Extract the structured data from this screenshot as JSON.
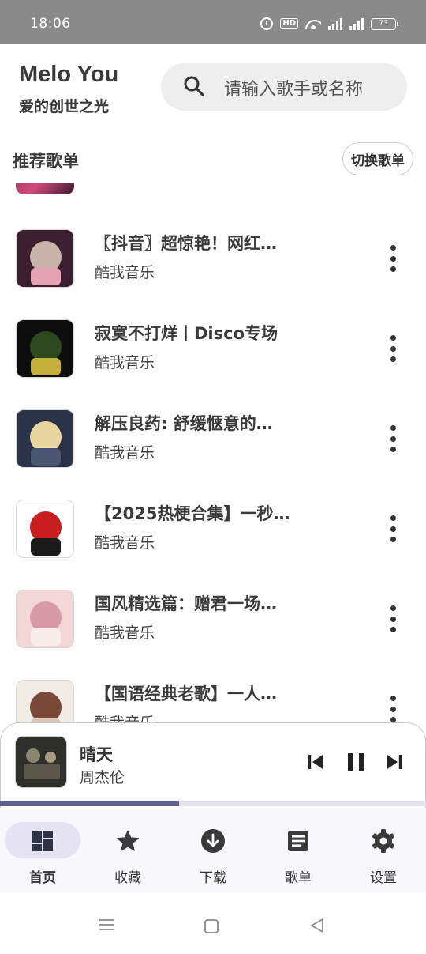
{
  "status_bar": {
    "time": "18:06",
    "hd_label": "HD",
    "battery": "73",
    "icons": [
      "alarm-icon",
      "hd-icon",
      "wifi-icon",
      "signal-icon",
      "signal-icon",
      "battery-icon"
    ]
  },
  "header": {
    "title": "Melo You",
    "subtitle": "爱的创世之光",
    "search_placeholder": "请输入歌手或名称"
  },
  "section": {
    "title": "推荐歌单",
    "switch_label": "切换歌单"
  },
  "playlists": [
    {
      "title": "〖抖音〗超惊艳！网红…",
      "source": "酷我音乐",
      "thumb_colors": [
        "#3b1f2e",
        "#c7b3a8",
        "#e7a3b6"
      ]
    },
    {
      "title": "寂寞不打烊丨Disco专场",
      "source": "酷我音乐",
      "thumb_colors": [
        "#0d0d0d",
        "#2d4a1e",
        "#c5b13a"
      ]
    },
    {
      "title": "解压良药: 舒缓惬意的…",
      "source": "酷我音乐",
      "thumb_colors": [
        "#2a3348",
        "#e8d8a0",
        "#4b5670"
      ]
    },
    {
      "title": "【2025热梗合集】一秒…",
      "source": "酷我音乐",
      "thumb_colors": [
        "#ffffff",
        "#c81e1e",
        "#1a1a1a"
      ]
    },
    {
      "title": "国风精选篇：赠君一场…",
      "source": "酷我音乐",
      "thumb_colors": [
        "#f3d6d8",
        "#d89aa4",
        "#f7eee8"
      ]
    },
    {
      "title": "【国语经典老歌】一人…",
      "source": "酷我音乐",
      "thumb_colors": [
        "#f1ece6",
        "#7a4a38",
        "#d9c7b8"
      ]
    }
  ],
  "player": {
    "title": "晴天",
    "artist": "周杰伦",
    "progress": 0.42,
    "controls": [
      "skip-previous-icon",
      "pause-icon",
      "skip-next-icon"
    ]
  },
  "bottom_nav": [
    {
      "label": "首页",
      "icon": "dashboard-icon",
      "active": true
    },
    {
      "label": "收藏",
      "icon": "star-icon",
      "active": false
    },
    {
      "label": "下载",
      "icon": "download-icon",
      "active": false
    },
    {
      "label": "歌单",
      "icon": "playlist-icon",
      "active": false
    },
    {
      "label": "设置",
      "icon": "gear-icon",
      "active": false
    }
  ],
  "colors": {
    "accent": "#5f5f8c",
    "nav_active_pill": "#e6e3f4",
    "status_bar": "#8a8a8a"
  }
}
